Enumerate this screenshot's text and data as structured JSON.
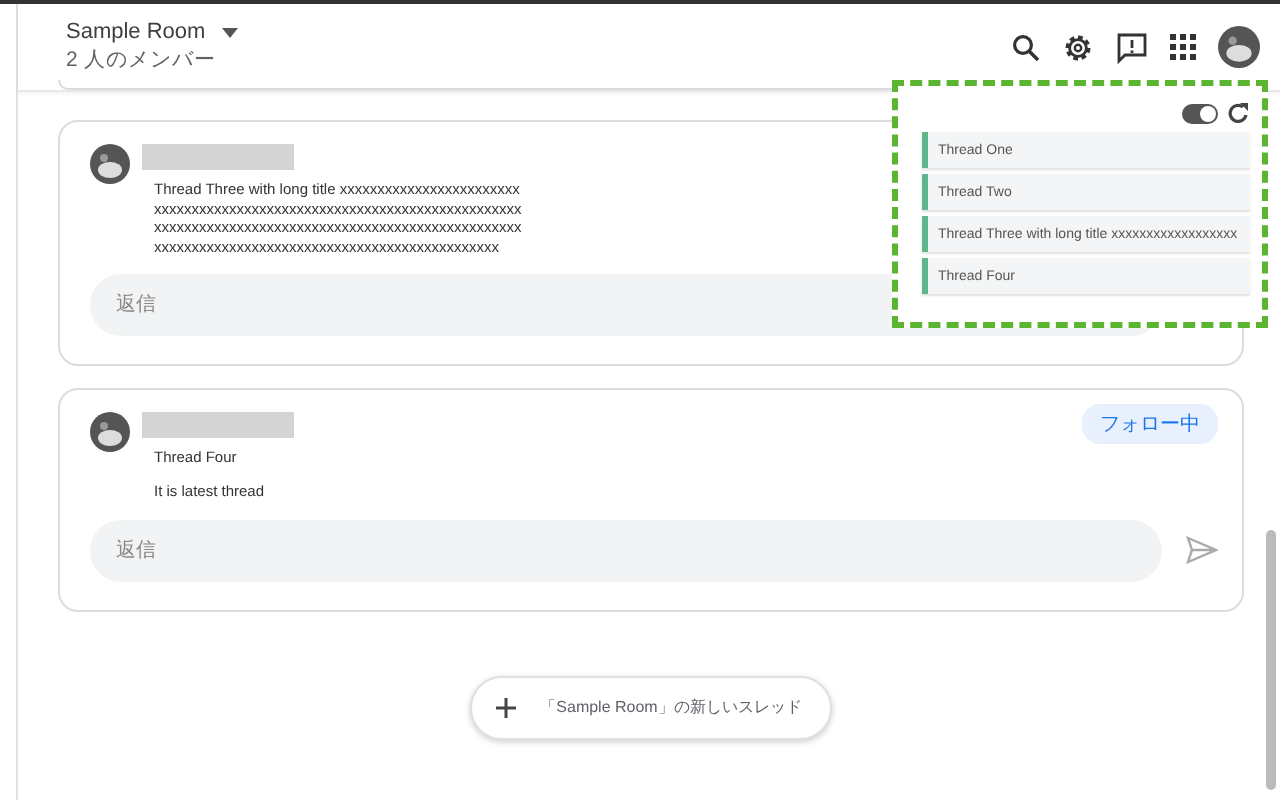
{
  "header": {
    "title": "Sample Room",
    "members": "2 人のメンバー"
  },
  "threads": [
    {
      "title": "Thread Three with long title xxxxxxxxxxxxxxxxxxxxxxxxxxxxxxxxxxxxxxxxxxxxxxxxxxxxxxxxxxxxxxxxxxxxxxxxxxxxxxxxxxxxxxxxxxxxxxxxxxxxxxxxxxxxxxxxxxxxxxxxxxxxxxxxxxxxxxxxxxxxxxxxxxxxxxxxxxxxxxxxxxxxxxxx",
      "reply_placeholder": "返信"
    },
    {
      "title": "Thread Four",
      "body": "It is latest thread",
      "follow": "フォロー中",
      "reply_placeholder": "返信"
    }
  ],
  "new_thread": "「Sample Room」の新しいスレッド",
  "overlay": {
    "toggle": {
      "on": true
    },
    "items": [
      {
        "label": "Thread One"
      },
      {
        "label": "Thread Two"
      },
      {
        "label": "Thread Three with long title xxxxxxxxxxxxxxxxxx"
      },
      {
        "label": "Thread Four"
      }
    ]
  }
}
